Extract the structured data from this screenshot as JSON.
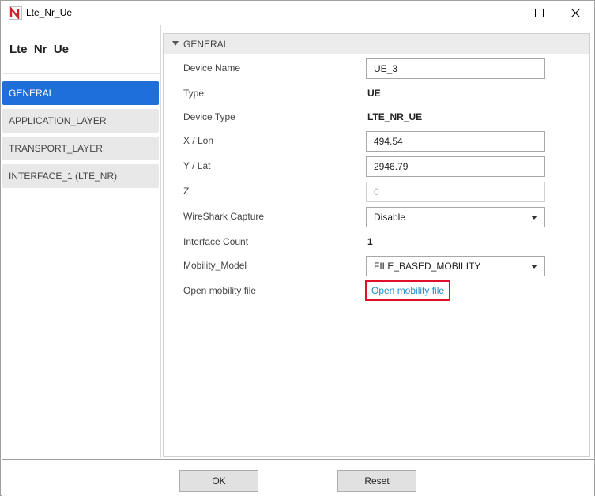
{
  "window": {
    "title": "Lte_Nr_Ue",
    "app_icon_letter": "N"
  },
  "sidebar": {
    "device_title": "Lte_Nr_Ue",
    "items": [
      {
        "label": "GENERAL",
        "active": true
      },
      {
        "label": "APPLICATION_LAYER",
        "active": false
      },
      {
        "label": "TRANSPORT_LAYER",
        "active": false
      },
      {
        "label": "INTERFACE_1 (LTE_NR)",
        "active": false
      }
    ]
  },
  "general": {
    "section_title": "GENERAL",
    "device_name": {
      "label": "Device Name",
      "value": "UE_3"
    },
    "type": {
      "label": "Type",
      "value": "UE"
    },
    "device_type": {
      "label": "Device Type",
      "value": "LTE_NR_UE"
    },
    "x_lon": {
      "label": "X / Lon",
      "value": "494.54"
    },
    "y_lat": {
      "label": "Y / Lat",
      "value": "2946.79"
    },
    "z": {
      "label": "Z",
      "value": "0"
    },
    "wireshark": {
      "label": "WireShark Capture",
      "value": "Disable"
    },
    "interface_count": {
      "label": "Interface Count",
      "value": "1"
    },
    "mobility_model": {
      "label": "Mobility_Model",
      "value": "FILE_BASED_MOBILITY"
    },
    "mobility_file": {
      "label": "Open mobility file",
      "link_text": "Open mobility file"
    }
  },
  "footer": {
    "ok_label": "OK",
    "reset_label": "Reset"
  },
  "colors": {
    "accent": "#1e6fd9",
    "highlight_box": "#e0102a",
    "link": "#1a8fd0"
  }
}
